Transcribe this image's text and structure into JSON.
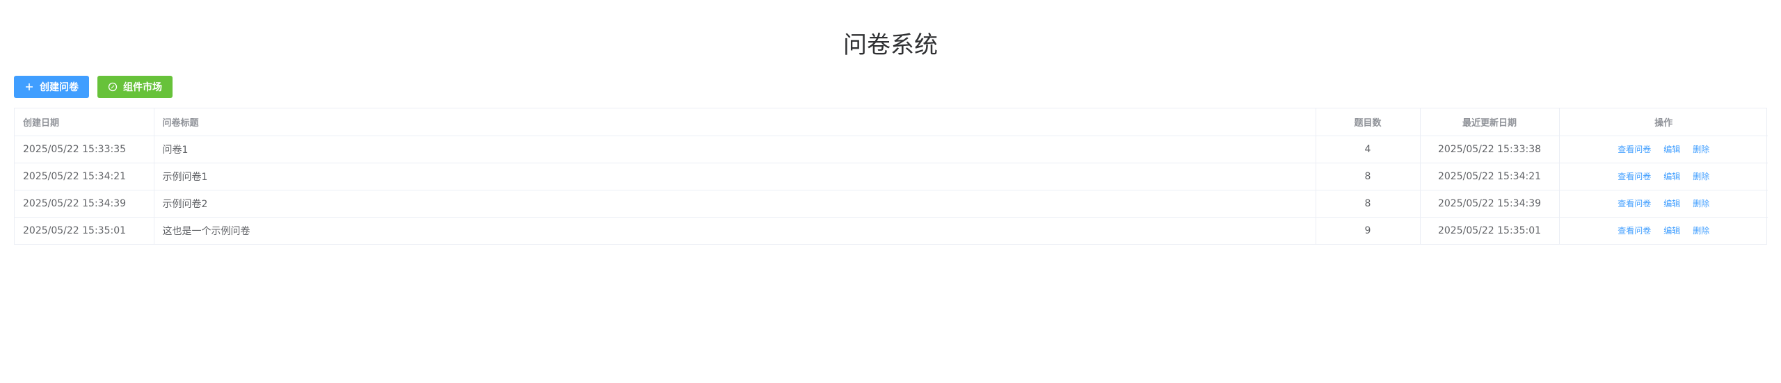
{
  "header": {
    "title": "问卷系统"
  },
  "toolbar": {
    "create_label": "创建问卷",
    "market_label": "组件市场"
  },
  "table": {
    "columns": [
      "创建日期",
      "问卷标题",
      "题目数",
      "最近更新日期",
      "操作"
    ],
    "rows": [
      {
        "created": "2025/05/22 15:33:35",
        "title": "问卷1",
        "count": "4",
        "updated": "2025/05/22 15:33:38"
      },
      {
        "created": "2025/05/22 15:34:21",
        "title": "示例问卷1",
        "count": "8",
        "updated": "2025/05/22 15:34:21"
      },
      {
        "created": "2025/05/22 15:34:39",
        "title": "示例问卷2",
        "count": "8",
        "updated": "2025/05/22 15:34:39"
      },
      {
        "created": "2025/05/22 15:35:01",
        "title": "这也是一个示例问卷",
        "count": "9",
        "updated": "2025/05/22 15:35:01"
      }
    ],
    "actions": {
      "view": "查看问卷",
      "edit": "编辑",
      "delete": "删除"
    }
  },
  "colors": {
    "primary": "#409eff",
    "success": "#67c23a"
  }
}
